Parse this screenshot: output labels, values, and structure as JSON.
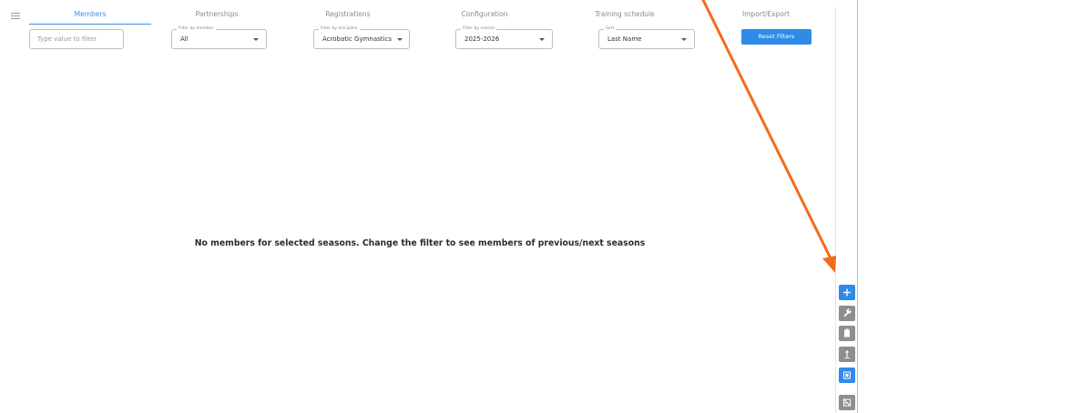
{
  "tabs": [
    {
      "label": "Members",
      "active": true
    },
    {
      "label": "Partnerships",
      "active": false
    },
    {
      "label": "Registrations",
      "active": false
    },
    {
      "label": "Configuration",
      "active": false
    },
    {
      "label": "Training schedule",
      "active": false
    },
    {
      "label": "Import/Export",
      "active": false
    }
  ],
  "filters": {
    "text": {
      "placeholder": "Type value to filter"
    },
    "member": {
      "label": "Filter by member",
      "value": "All"
    },
    "discipline": {
      "label": "Filter by discipline",
      "value": "Acrobatic Gymnastics"
    },
    "season": {
      "label": "Filter by season",
      "value": "2025-2026"
    },
    "sort": {
      "label": "Sort",
      "value": "Last Name"
    }
  },
  "reset_label": "Reset Filters",
  "empty_message": "No members for selected seasons. Change the filter to see members of previous/next seasons",
  "side_toolbar": [
    {
      "name": "add-icon",
      "color": "#2f8be8"
    },
    {
      "name": "wrench-icon",
      "color": "#8e8e8e"
    },
    {
      "name": "clipboard-icon",
      "color": "#8e8e8e"
    },
    {
      "name": "upload-icon",
      "color": "#8e8e8e"
    },
    {
      "name": "select-all-icon",
      "color": "#2f8be8"
    },
    {
      "name": "deselect-icon",
      "color": "#8e8e8e"
    }
  ],
  "colors": {
    "accent": "#2f8be8",
    "annotation": "#f26b1f"
  }
}
